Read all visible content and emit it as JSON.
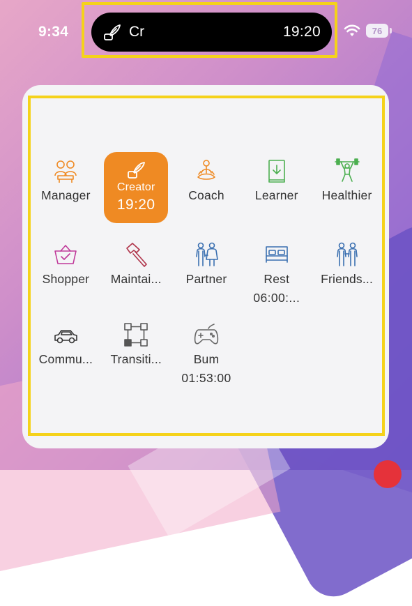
{
  "status_bar": {
    "time": "9:34",
    "battery_level": "76"
  },
  "live_activity": {
    "icon": "quill-pen-icon",
    "label": "Cr",
    "timer": "19:20"
  },
  "widget": {
    "activities": [
      {
        "key": "manager",
        "label": "Manager",
        "icon": "people-meeting-icon",
        "color": "#ef8a23"
      },
      {
        "key": "creator",
        "label": "Creator",
        "sub": "19:20",
        "icon": "quill-pen-icon",
        "color": "#ffffff",
        "active": true
      },
      {
        "key": "coach",
        "label": "Coach",
        "icon": "meditation-icon",
        "color": "#ef8a23"
      },
      {
        "key": "learner",
        "label": "Learner",
        "icon": "book-download-icon",
        "color": "#4caf50"
      },
      {
        "key": "healthier",
        "label": "Healthier",
        "icon": "weightlifter-icon",
        "color": "#4caf50"
      },
      {
        "key": "shopper",
        "label": "Shopper",
        "icon": "shopping-basket-icon",
        "color": "#c0399a"
      },
      {
        "key": "maintainer",
        "label": "Maintai...",
        "icon": "hammer-icon",
        "color": "#b0344a"
      },
      {
        "key": "partner",
        "label": "Partner",
        "icon": "couple-icon",
        "color": "#3a6fb0"
      },
      {
        "key": "rest",
        "label": "Rest",
        "sub": "06:00:...",
        "icon": "bed-icon",
        "color": "#3a6fb0"
      },
      {
        "key": "friends",
        "label": "Friends...",
        "icon": "friends-icon",
        "color": "#3a6fb0"
      },
      {
        "key": "commute",
        "label": "Commu...",
        "icon": "car-icon",
        "color": "#333333"
      },
      {
        "key": "transition",
        "label": "Transiti...",
        "icon": "flowchart-icon",
        "color": "#555555"
      },
      {
        "key": "bum",
        "label": "Bum",
        "sub": "01:53:00",
        "icon": "gamepad-icon",
        "color": "#666666"
      }
    ]
  },
  "colors": {
    "highlight_outline": "#f5d21a",
    "active_tile": "#ef8a23",
    "island": "#000000"
  }
}
